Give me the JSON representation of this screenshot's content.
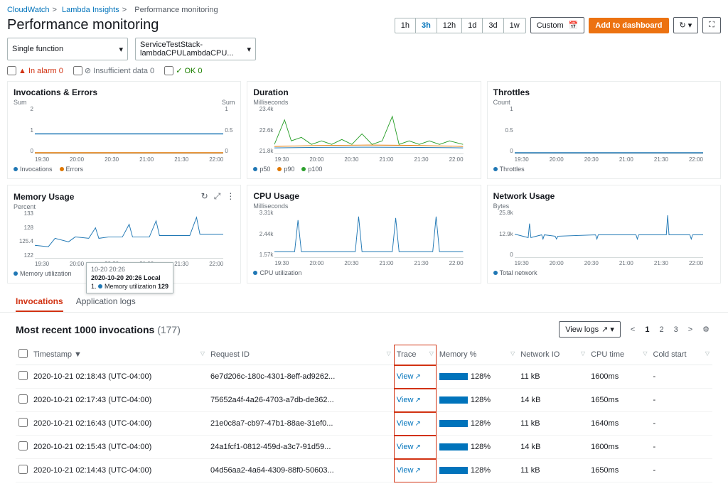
{
  "breadcrumb": {
    "a": "CloudWatch",
    "b": "Lambda Insights",
    "c": "Performance monitoring"
  },
  "title": "Performance monitoring",
  "time": {
    "options": [
      "1h",
      "3h",
      "12h",
      "1d",
      "3d",
      "1w"
    ],
    "custom": "Custom",
    "selected": "3h"
  },
  "addDash": "Add to dashboard",
  "selectors": {
    "mode": "Single function",
    "fn": "ServiceTestStack-lambdaCPULambdaCPU..."
  },
  "status": {
    "alarm": "In alarm 0",
    "insuf": "Insufficient data 0",
    "ok": "OK 0"
  },
  "charts": [
    {
      "title": "Invocations & Errors",
      "sub": "Sum",
      "subR": "Sum",
      "legend": [
        {
          "c": "#1f77b4",
          "t": "Invocations"
        },
        {
          "c": "#e07700",
          "t": "Errors"
        }
      ],
      "y": [
        "2",
        "1",
        "0"
      ],
      "yr": [
        "1",
        "0.5",
        "0"
      ]
    },
    {
      "title": "Duration",
      "sub": "Milliseconds",
      "legend": [
        {
          "c": "#1f77b4",
          "t": "p50"
        },
        {
          "c": "#e07700",
          "t": "p90"
        },
        {
          "c": "#2ca02c",
          "t": "p100"
        }
      ],
      "y": [
        "23.4k",
        "22.6k",
        "21.8k"
      ]
    },
    {
      "title": "Throttles",
      "sub": "Count",
      "legend": [
        {
          "c": "#1f77b4",
          "t": "Throttles"
        }
      ],
      "y": [
        "1",
        "0.5",
        "0"
      ]
    },
    {
      "title": "Memory Usage",
      "sub": "Percent",
      "legend": [
        {
          "c": "#1f77b4",
          "t": "Memory utilization"
        }
      ],
      "y": [
        "133",
        "128",
        "125.4",
        "122"
      ],
      "icons": true
    },
    {
      "title": "CPU Usage",
      "sub": "Milliseconds",
      "legend": [
        {
          "c": "#1f77b4",
          "t": "CPU utilization"
        }
      ],
      "y": [
        "3.31k",
        "2.44k",
        "1.57k"
      ]
    },
    {
      "title": "Network Usage",
      "sub": "Bytes",
      "legend": [
        {
          "c": "#1f77b4",
          "t": "Total network"
        }
      ],
      "y": [
        "25.8k",
        "12.9k",
        "0"
      ]
    }
  ],
  "xticks": [
    "19:30",
    "20:00",
    "20:30",
    "21:00",
    "21:30",
    "22:00"
  ],
  "tooltip": {
    "time": "10-20 20:26",
    "title": "2020-10-20 20:26 Local",
    "label": "Memory utilization",
    "val": "129"
  },
  "tabs": {
    "a": "Invocations",
    "b": "Application logs"
  },
  "table": {
    "title": "Most recent 1000 invocations",
    "count": "(177)",
    "viewLogs": "View logs",
    "cols": [
      "Timestamp",
      "Request ID",
      "Trace",
      "Memory %",
      "Network IO",
      "CPU time",
      "Cold start"
    ],
    "rows": [
      {
        "ts": "2020-10-21 02:18:43 (UTC-04:00)",
        "rid": "6e7d206c-180c-4301-8eff-ad9262...",
        "trace": "View",
        "mem": "128%",
        "net": "11 kB",
        "cpu": "1600ms",
        "cold": "-"
      },
      {
        "ts": "2020-10-21 02:17:43 (UTC-04:00)",
        "rid": "75652a4f-4a26-4703-a7db-de362...",
        "trace": "View",
        "mem": "128%",
        "net": "14 kB",
        "cpu": "1650ms",
        "cold": "-"
      },
      {
        "ts": "2020-10-21 02:16:43 (UTC-04:00)",
        "rid": "21e0c8a7-cb97-47b1-88ae-31ef0...",
        "trace": "View",
        "mem": "128%",
        "net": "11 kB",
        "cpu": "1640ms",
        "cold": "-"
      },
      {
        "ts": "2020-10-21 02:15:43 (UTC-04:00)",
        "rid": "24a1fcf1-0812-459d-a3c7-91d59...",
        "trace": "View",
        "mem": "128%",
        "net": "14 kB",
        "cpu": "1600ms",
        "cold": "-"
      },
      {
        "ts": "2020-10-21 02:14:43 (UTC-04:00)",
        "rid": "04d56aa2-4a64-4309-88f0-50603...",
        "trace": "View",
        "mem": "128%",
        "net": "11 kB",
        "cpu": "1650ms",
        "cold": "-"
      }
    ]
  },
  "chart_data": [
    {
      "type": "line",
      "title": "Invocations & Errors",
      "x": [
        "19:30",
        "20:00",
        "20:30",
        "21:00",
        "21:30",
        "22:00"
      ],
      "series": [
        {
          "name": "Invocations",
          "values": [
            1,
            1,
            1,
            1,
            1,
            1
          ]
        },
        {
          "name": "Errors",
          "values": [
            0,
            0,
            0,
            0,
            0,
            0
          ]
        }
      ],
      "ylim": [
        0,
        2
      ]
    },
    {
      "type": "line",
      "title": "Duration",
      "x": [
        "19:30",
        "20:00",
        "20:30",
        "21:00",
        "21:30",
        "22:00"
      ],
      "series": [
        {
          "name": "p50",
          "values": [
            22000,
            22100,
            22000,
            22100,
            22000,
            22100
          ]
        },
        {
          "name": "p90",
          "values": [
            22200,
            22300,
            22200,
            22300,
            22200,
            22300
          ]
        },
        {
          "name": "p100",
          "values": [
            22400,
            23200,
            22400,
            22600,
            23400,
            22400
          ]
        }
      ],
      "ylim": [
        21800,
        23400
      ],
      "ylabel": "Milliseconds"
    },
    {
      "type": "line",
      "title": "Throttles",
      "x": [
        "19:30",
        "20:00",
        "20:30",
        "21:00",
        "21:30",
        "22:00"
      ],
      "series": [
        {
          "name": "Throttles",
          "values": [
            0,
            0,
            0,
            0,
            0,
            0
          ]
        }
      ],
      "ylim": [
        0,
        1
      ]
    },
    {
      "type": "line",
      "title": "Memory Usage",
      "x": [
        "19:30",
        "20:00",
        "20:30",
        "21:00",
        "21:30",
        "22:00"
      ],
      "series": [
        {
          "name": "Memory utilization",
          "values": [
            124,
            126,
            128,
            128,
            129,
            128
          ]
        }
      ],
      "ylim": [
        122,
        133
      ],
      "ylabel": "Percent"
    },
    {
      "type": "line",
      "title": "CPU Usage",
      "x": [
        "19:30",
        "20:00",
        "20:30",
        "21:00",
        "21:30",
        "22:00"
      ],
      "series": [
        {
          "name": "CPU utilization",
          "values": [
            1700,
            1700,
            1700,
            1700,
            1700,
            1700
          ]
        }
      ],
      "ylim": [
        1570,
        3310
      ],
      "ylabel": "Milliseconds"
    },
    {
      "type": "line",
      "title": "Network Usage",
      "x": [
        "19:30",
        "20:00",
        "20:30",
        "21:00",
        "21:30",
        "22:00"
      ],
      "series": [
        {
          "name": "Total network",
          "values": [
            13000,
            13500,
            13000,
            13500,
            13000,
            13500
          ]
        }
      ],
      "ylim": [
        0,
        25800
      ],
      "ylabel": "Bytes"
    }
  ]
}
